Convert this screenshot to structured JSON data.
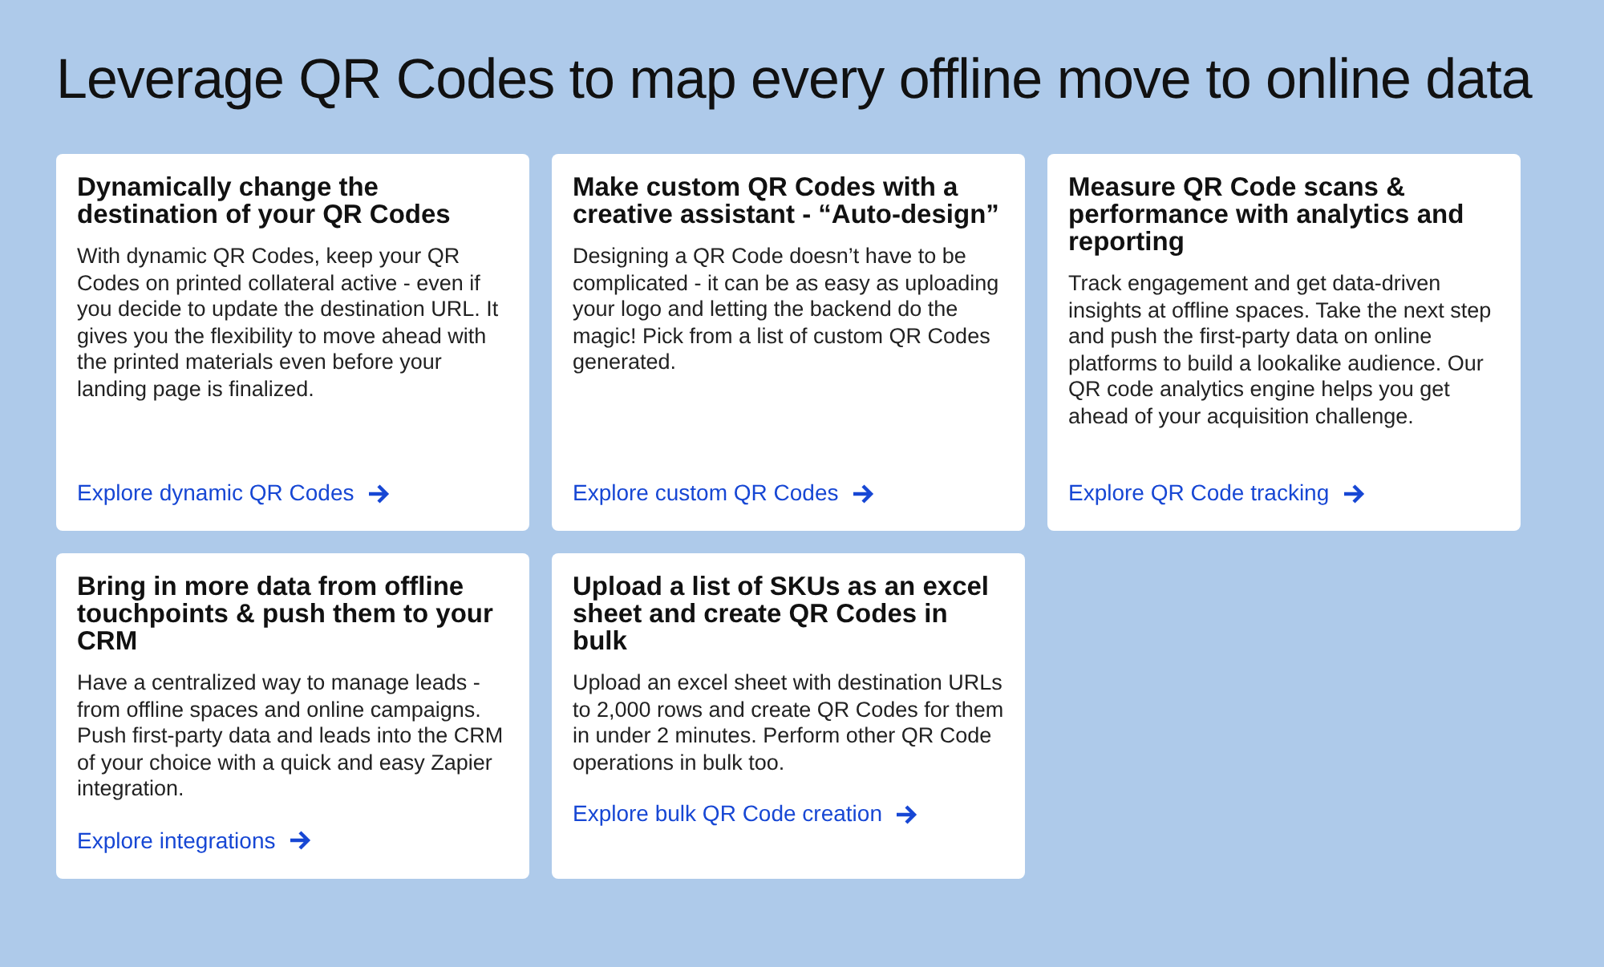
{
  "heading": "Leverage QR Codes to map every offline move to online data",
  "cards": [
    {
      "title": "Dynamically change the destination of your QR Codes",
      "body": "With dynamic QR Codes, keep your QR Codes on printed collateral active - even if you decide to update the destination URL. It gives you the flexibility to move ahead with the printed materials even before your landing page is finalized.",
      "link": "Explore dynamic QR Codes"
    },
    {
      "title": "Make custom QR Codes with a creative assistant - “Auto-design”",
      "body": "Designing a QR Code doesn’t have to be complicated - it can be as easy as uploading your logo and letting the backend do the magic! Pick from a list of custom QR Codes generated.",
      "link": "Explore custom QR Codes"
    },
    {
      "title": "Measure QR Code scans & performance with analytics and reporting",
      "body": "Track engagement and get data-driven insights at offline spaces. Take the next step and push the first-party data on online platforms to build a lookalike audience. Our QR code analytics engine helps you get ahead of your acquisition challenge.",
      "link": "Explore QR Code tracking"
    },
    {
      "title": "Bring in more data from offline touchpoints & push them to your CRM",
      "body": "Have a centralized way to manage leads - from offline spaces and online campaigns. Push first-party data and leads into the CRM of your choice with a quick and easy Zapier integration.",
      "link": "Explore integrations"
    },
    {
      "title": "Upload a list of SKUs as an excel sheet and create QR Codes in bulk",
      "body": "Upload an excel sheet with destination URLs to 2,000 rows and create QR Codes for them in under 2 minutes. Perform other QR Code operations in bulk too.",
      "link": "Explore bulk QR Code creation"
    }
  ]
}
